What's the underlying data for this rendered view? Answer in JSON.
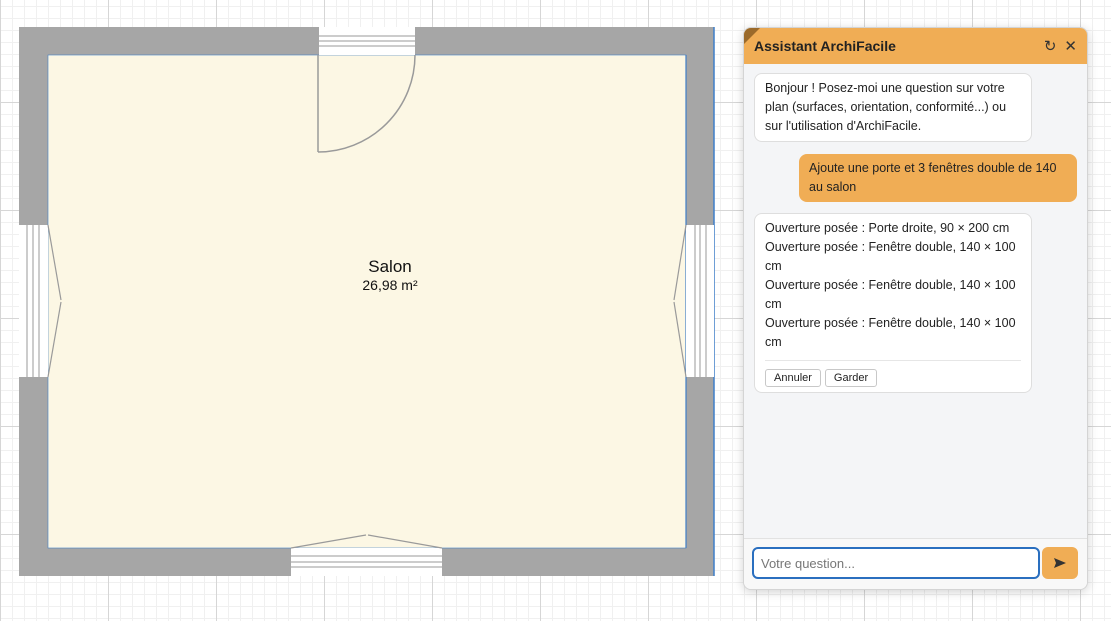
{
  "plan": {
    "room": {
      "name": "Salon",
      "area": "26,98 m²"
    }
  },
  "chat": {
    "title": "Assistant ArchiFacile",
    "refresh_icon": "↻",
    "close_icon": "✕",
    "messages": [
      {
        "role": "assistant",
        "text": "Bonjour ! Posez-moi une question sur votre plan (surfaces, orientation, conformité...) ou sur l'utilisation d'ArchiFacile."
      },
      {
        "role": "user",
        "text": "Ajoute une porte et 3 fenêtres double de 140 au salon"
      },
      {
        "role": "assistant",
        "lines": [
          "Ouverture posée : Porte droite, 90 × 200 cm",
          "Ouverture posée : Fenêtre double, 140 × 100 cm",
          "Ouverture posée : Fenêtre double, 140 × 100 cm",
          "Ouverture posée : Fenêtre double, 140 × 100 cm"
        ],
        "actions": {
          "undo": "Annuler",
          "keep": "Garder"
        }
      }
    ],
    "input": {
      "placeholder": "Votre question...",
      "value": ""
    },
    "send_icon": "send-arrow-icon"
  },
  "colors": {
    "wall": "#a6a6a6",
    "floor": "#fcf7e4",
    "accent": "#f0ad55",
    "input_border": "#2a6fbf"
  }
}
